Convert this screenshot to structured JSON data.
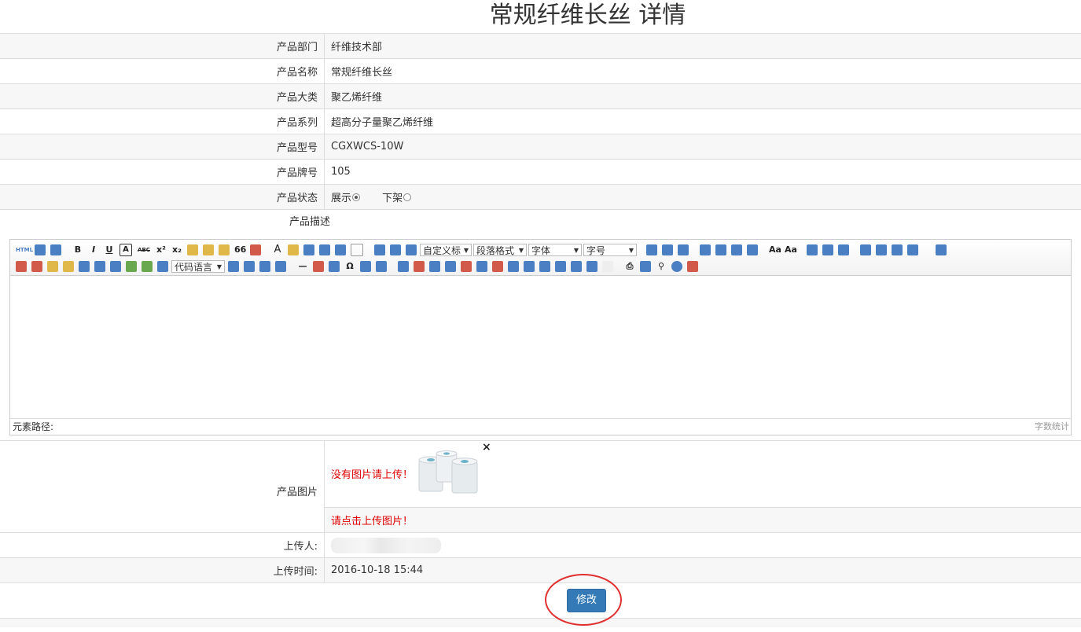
{
  "page": {
    "title": "常规纤维长丝 详情"
  },
  "fields": [
    {
      "label": "产品部门",
      "value": "纤维技术部"
    },
    {
      "label": "产品名称",
      "value": "常规纤维长丝"
    },
    {
      "label": "产品大类",
      "value": "聚乙烯纤维"
    },
    {
      "label": "产品系列",
      "value": "超高分子量聚乙烯纤维"
    },
    {
      "label": "产品型号",
      "value": "CGXWCS-10W"
    },
    {
      "label": "产品牌号",
      "value": "105"
    }
  ],
  "status": {
    "label": "产品状态",
    "options": [
      {
        "label": "展示",
        "checked": true
      },
      {
        "label": "下架",
        "checked": false
      }
    ]
  },
  "description": {
    "label": "产品描述",
    "toolbar": {
      "custom_title": "自定义标",
      "paragraph": "段落格式",
      "font": "字体",
      "font_size": "字号",
      "code_language": "代码语言",
      "html_btn": "HTML",
      "bold": "B",
      "italic": "I",
      "underline": "U",
      "strike": "ABC",
      "quote": "66",
      "font_color": "A"
    },
    "element_path": "元素路径:",
    "word_count": "字数统计"
  },
  "image": {
    "label": "产品图片",
    "no_image_msg": "没有图片请上传！",
    "close_icon": "×",
    "upload_msg": "请点击上传图片！"
  },
  "uploader": {
    "label": "上传人:"
  },
  "upload_time": {
    "label": "上传时间:",
    "value": "2016-10-18 15:44"
  },
  "actions": {
    "modify": "修改"
  },
  "colors": {
    "primary": "#337ab7",
    "error": "#dd0000",
    "highlight_ring": "#e03030"
  }
}
